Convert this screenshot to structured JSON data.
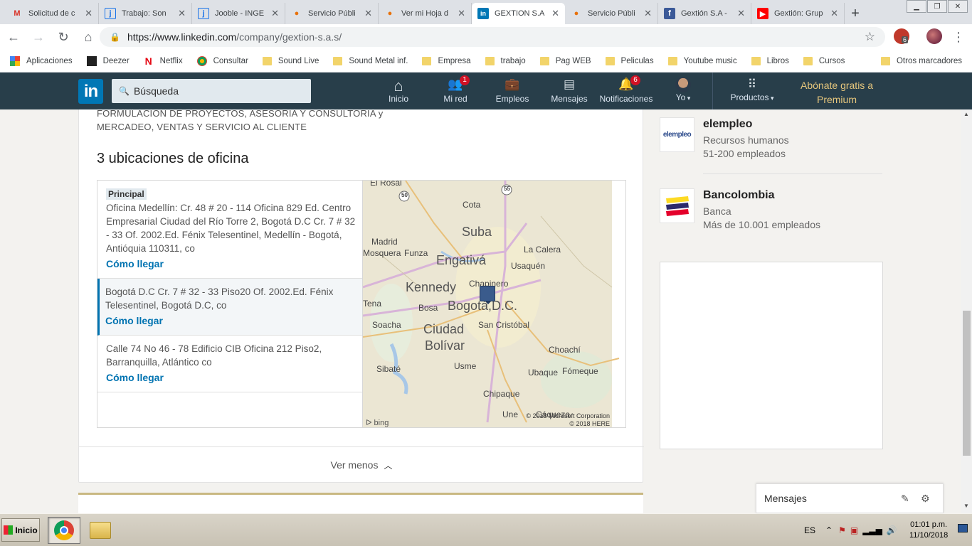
{
  "browser": {
    "tabs": [
      {
        "title": "Solicitud de c",
        "icon": "gmail-icon",
        "color": "#d93025"
      },
      {
        "title": "Trabajo: Son",
        "icon": "jooble-icon",
        "color": "#1a73e8"
      },
      {
        "title": "Jooble - INGE",
        "icon": "jooble-icon",
        "color": "#1a73e8"
      },
      {
        "title": "Servicio Públi",
        "icon": "servicio-icon",
        "color": "#e8710a"
      },
      {
        "title": "Ver mi Hoja d",
        "icon": "servicio-icon",
        "color": "#e8710a"
      },
      {
        "title": "GEXTION S.A",
        "icon": "linkedin-icon",
        "color": "#0077b5",
        "active": true
      },
      {
        "title": "Servicio Públi",
        "icon": "servicio-icon",
        "color": "#e8710a"
      },
      {
        "title": "Gextión S.A -",
        "icon": "facebook-icon",
        "color": "#3b5998"
      },
      {
        "title": "Gextión: Grup",
        "icon": "youtube-icon",
        "color": "#ff0000"
      }
    ],
    "url_host": "https://www.linkedin.com",
    "url_path": "/company/gextion-s.a.s/",
    "ext_badge": "6",
    "bookmarks": [
      {
        "label": "Aplicaciones",
        "icon": "apps-icon"
      },
      {
        "label": "Deezer",
        "icon": "deezer-icon"
      },
      {
        "label": "Netflix",
        "icon": "netflix-icon"
      },
      {
        "label": "Consultar",
        "icon": "consultar-icon"
      },
      {
        "label": "Sound Live",
        "icon": "folder-icon"
      },
      {
        "label": "Sound Metal inf.",
        "icon": "folder-icon"
      },
      {
        "label": "Empresa",
        "icon": "folder-icon"
      },
      {
        "label": "trabajo",
        "icon": "folder-icon"
      },
      {
        "label": "Pag WEB",
        "icon": "folder-icon"
      },
      {
        "label": "Peliculas",
        "icon": "folder-icon"
      },
      {
        "label": "Youtube music",
        "icon": "folder-icon"
      },
      {
        "label": "Libros",
        "icon": "folder-icon"
      },
      {
        "label": "Cursos",
        "icon": "folder-icon"
      }
    ],
    "other_bookmarks": "Otros marcadores"
  },
  "linkedin": {
    "logo": "in",
    "search_placeholder": "Búsqueda",
    "nav": [
      {
        "label": "Inicio",
        "icon": "home-icon"
      },
      {
        "label": "Mi red",
        "icon": "network-icon",
        "badge": "1"
      },
      {
        "label": "Empleos",
        "icon": "jobs-icon"
      },
      {
        "label": "Mensajes",
        "icon": "messaging-icon"
      },
      {
        "label": "Notificaciones",
        "icon": "bell-icon",
        "badge": "6"
      },
      {
        "label": "Yo",
        "icon": "avatar-icon"
      },
      {
        "label": "Productos",
        "icon": "grid-icon"
      }
    ],
    "premium": "Abónate gratis a Premium"
  },
  "main": {
    "specialties_line1": "FORMULACION DE PROYECTOS, ASESORIA Y CONSULTORIA y",
    "specialties_line2": "MERCADEO, VENTAS Y SERVICIO AL CLIENTE",
    "locations_title": "3 ubicaciones de oficina",
    "primary_tag": "Principal",
    "locations": [
      {
        "address": "Oficina Medellín: Cr. 48 # 20 - 114 Oficina 829 Ed. Centro Empresarial Ciudad del Río Torre 2, Bogotá D.C Cr. 7 # 32 - 33 Of. 2002.Ed. Fénix Telesentinel, Medellín - Bogotá, Antióquia 110311, co",
        "link": "Cómo llegar"
      },
      {
        "address": "Bogotá D.C Cr. 7 # 32 - 33 Piso20 Of. 2002.Ed. Fénix Telesentinel, Bogotá D.C, co",
        "link": "Cómo llegar"
      },
      {
        "address": "Calle 74 No 46 - 78 Edificio CIB Oficina 212 Piso2, Barranquilla, Atlántico co",
        "link": "Cómo llegar"
      }
    ],
    "map": {
      "labels": [
        "El Rosal",
        "Cota",
        "Suba",
        "Madrid",
        "Mosquera",
        "Funza",
        "Engativá",
        "La Calera",
        "Usaquén",
        "Kennedy",
        "Chapinero",
        "Tena",
        "Bosa",
        "Bogotá,D.C.",
        "Soacha",
        "Ciudad",
        "Bolívar",
        "San Cristóbal",
        "Choachí",
        "Sibaté",
        "Usme",
        "Ubaque",
        "Fómeque",
        "Chipaque",
        "Une",
        "Cáqueza"
      ],
      "road_labels": [
        "50",
        "55"
      ],
      "copyright1": "© 2018 Microsoft Corporation",
      "copyright2": "© 2018 HERE",
      "provider": "bing"
    },
    "toggle_label": "Ver menos"
  },
  "rail": {
    "companies": [
      {
        "name": "elempleo",
        "industry": "Recursos humanos",
        "size": "51-200 empleados",
        "logo_text": "elempleo"
      },
      {
        "name": "Bancolombia",
        "industry": "Banca",
        "size": "Más de 10.001 empleados"
      }
    ]
  },
  "messaging": {
    "label": "Mensajes"
  },
  "taskbar": {
    "start": "Inicio",
    "lang": "ES",
    "time": "01:01 p.m.",
    "date": "11/10/2018"
  }
}
